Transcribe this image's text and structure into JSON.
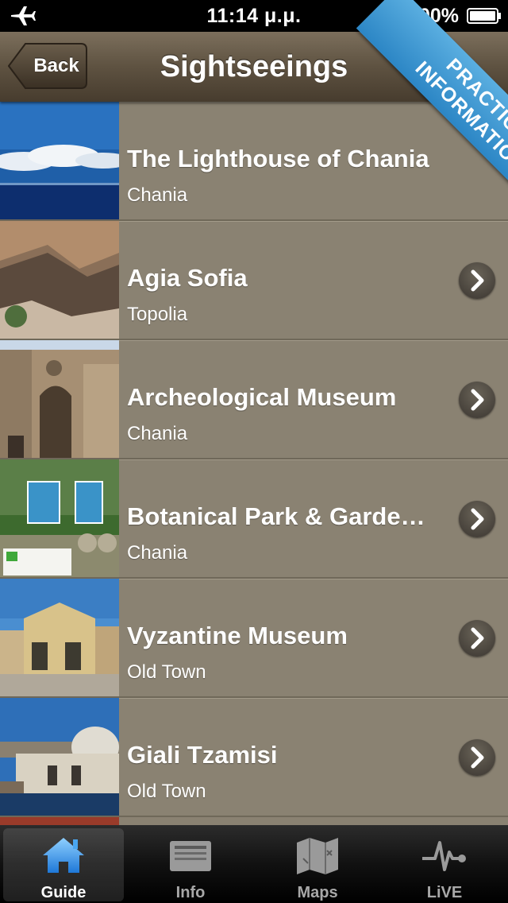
{
  "status_bar": {
    "time": "11:14 μ.μ.",
    "battery": "100%"
  },
  "nav": {
    "back_label": "Back",
    "title": "Sightseeings"
  },
  "ribbon": {
    "line1": "PRACTICAL",
    "line2": "INFORMATIONS"
  },
  "items": [
    {
      "title": "The Lighthouse of Chania",
      "subtitle": "Chania"
    },
    {
      "title": "Agia Sofia",
      "subtitle": "Topolia"
    },
    {
      "title": "Archeological Museum",
      "subtitle": "Chania"
    },
    {
      "title": "Botanical Park & Garde…",
      "subtitle": "Chania"
    },
    {
      "title": "Vyzantine Museum",
      "subtitle": "Old Town"
    },
    {
      "title": "Giali Tzamisi",
      "subtitle": "Old Town"
    }
  ],
  "tabs": [
    {
      "label": "Guide",
      "icon": "home-icon"
    },
    {
      "label": "Info",
      "icon": "newspaper-icon"
    },
    {
      "label": "Maps",
      "icon": "map-icon"
    },
    {
      "label": "LiVE",
      "icon": "pulse-icon"
    }
  ],
  "colors": {
    "row_background": "#8a8272",
    "navbar": "#5e5241",
    "ribbon": "#3a96d2"
  }
}
